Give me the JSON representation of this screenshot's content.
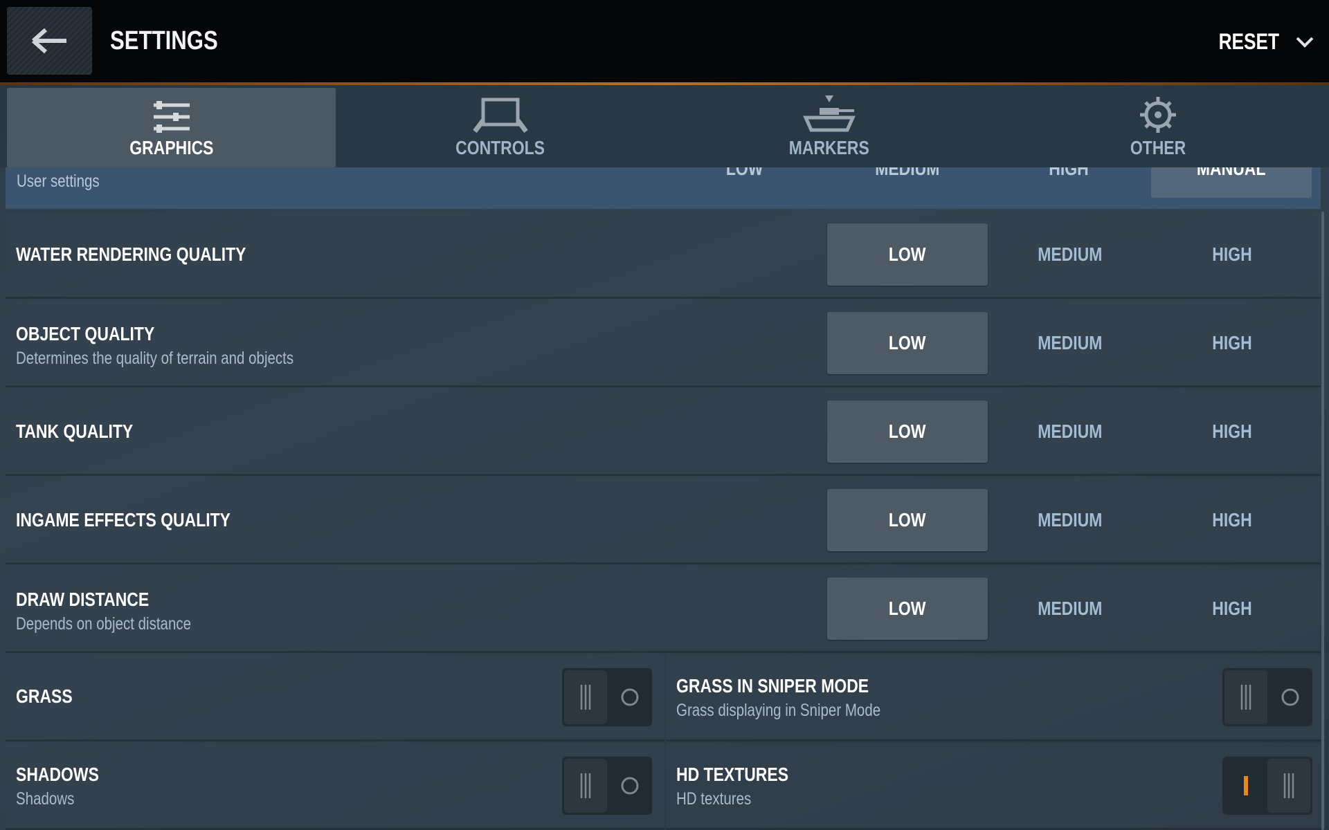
{
  "header": {
    "title": "SETTINGS",
    "reset_label": "RESET"
  },
  "tabs": [
    {
      "label": "GRAPHICS",
      "icon": "sliders-icon",
      "active": true
    },
    {
      "label": "CONTROLS",
      "icon": "controls-icon"
    },
    {
      "label": "MARKERS",
      "icon": "tank-marker-icon"
    },
    {
      "label": "OTHER",
      "icon": "gear-icon"
    }
  ],
  "preset": {
    "label": "User settings",
    "options": [
      "LOW",
      "MEDIUM",
      "HIGH",
      "MANUAL"
    ],
    "selected": "MANUAL"
  },
  "quality_rows": [
    {
      "name": "WATER RENDERING QUALITY",
      "sub": "",
      "options": [
        "LOW",
        "MEDIUM",
        "HIGH"
      ],
      "selected": "LOW"
    },
    {
      "name": "OBJECT QUALITY",
      "sub": "Determines the quality of terrain and objects",
      "options": [
        "LOW",
        "MEDIUM",
        "HIGH"
      ],
      "selected": "LOW"
    },
    {
      "name": "TANK QUALITY",
      "sub": "",
      "options": [
        "LOW",
        "MEDIUM",
        "HIGH"
      ],
      "selected": "LOW"
    },
    {
      "name": "INGAME EFFECTS QUALITY",
      "sub": "",
      "options": [
        "LOW",
        "MEDIUM",
        "HIGH"
      ],
      "selected": "LOW"
    },
    {
      "name": "DRAW DISTANCE",
      "sub": "Depends on object distance",
      "options": [
        "LOW",
        "MEDIUM",
        "HIGH"
      ],
      "selected": "LOW"
    }
  ],
  "toggles": [
    {
      "name": "GRASS",
      "sub": "",
      "on": false
    },
    {
      "name": "GRASS IN SNIPER MODE",
      "sub": "Grass displaying in Sniper Mode",
      "on": false
    },
    {
      "name": "SHADOWS",
      "sub": "Shadows",
      "on": false
    },
    {
      "name": "HD TEXTURES",
      "sub": "HD textures",
      "on": true
    }
  ],
  "colors": {
    "accent": "#e88a1a",
    "header_bg": "#050607",
    "preset_bar": "#3b5570"
  }
}
